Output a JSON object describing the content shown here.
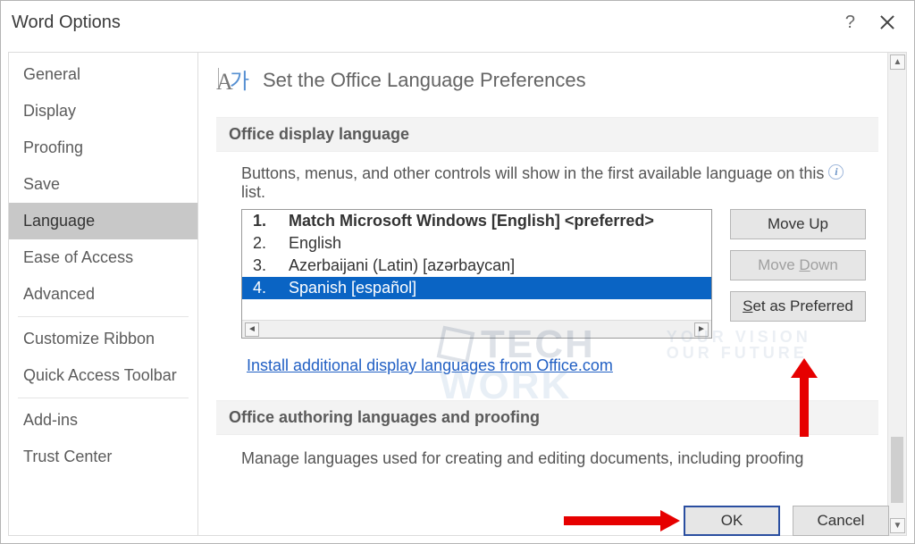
{
  "window": {
    "title": "Word Options"
  },
  "sidebar": {
    "items": [
      {
        "label": "General"
      },
      {
        "label": "Display"
      },
      {
        "label": "Proofing"
      },
      {
        "label": "Save"
      },
      {
        "label": "Language",
        "selected": true
      },
      {
        "label": "Ease of Access"
      },
      {
        "label": "Advanced"
      },
      {
        "label": "Customize Ribbon"
      },
      {
        "label": "Quick Access Toolbar"
      },
      {
        "label": "Add-ins"
      },
      {
        "label": "Trust Center"
      }
    ]
  },
  "page": {
    "heading": "Set the Office Language Preferences",
    "section1": {
      "title": "Office display language",
      "description_pre": "Buttons, menus, and other controls will show in the first available language on this",
      "description_post": "list.",
      "languages": [
        {
          "index": "1.",
          "name": "Match Microsoft Windows [English] <preferred>",
          "bold": true,
          "selected": false
        },
        {
          "index": "2.",
          "name": "English",
          "bold": false,
          "selected": false
        },
        {
          "index": "3.",
          "name": "Azerbaijani (Latin) [azərbaycan]",
          "bold": false,
          "selected": false
        },
        {
          "index": "4.",
          "name": "Spanish [español]",
          "bold": false,
          "selected": true
        }
      ],
      "link": "Install additional display languages from Office.com"
    },
    "buttons": {
      "move_up": "Move Up",
      "move_down": "Move Down",
      "set_preferred_prefix": "S",
      "set_preferred_rest": "et as Preferred"
    },
    "section2": {
      "title": "Office authoring languages and proofing",
      "description": "Manage languages used for creating and editing documents, including proofing"
    }
  },
  "footer": {
    "ok": "OK",
    "cancel": "Cancel"
  },
  "watermark": {
    "line1": "TECH",
    "line2": "WORK",
    "tag1": "YOUR VISION",
    "tag2": "OUR FUTURE"
  }
}
